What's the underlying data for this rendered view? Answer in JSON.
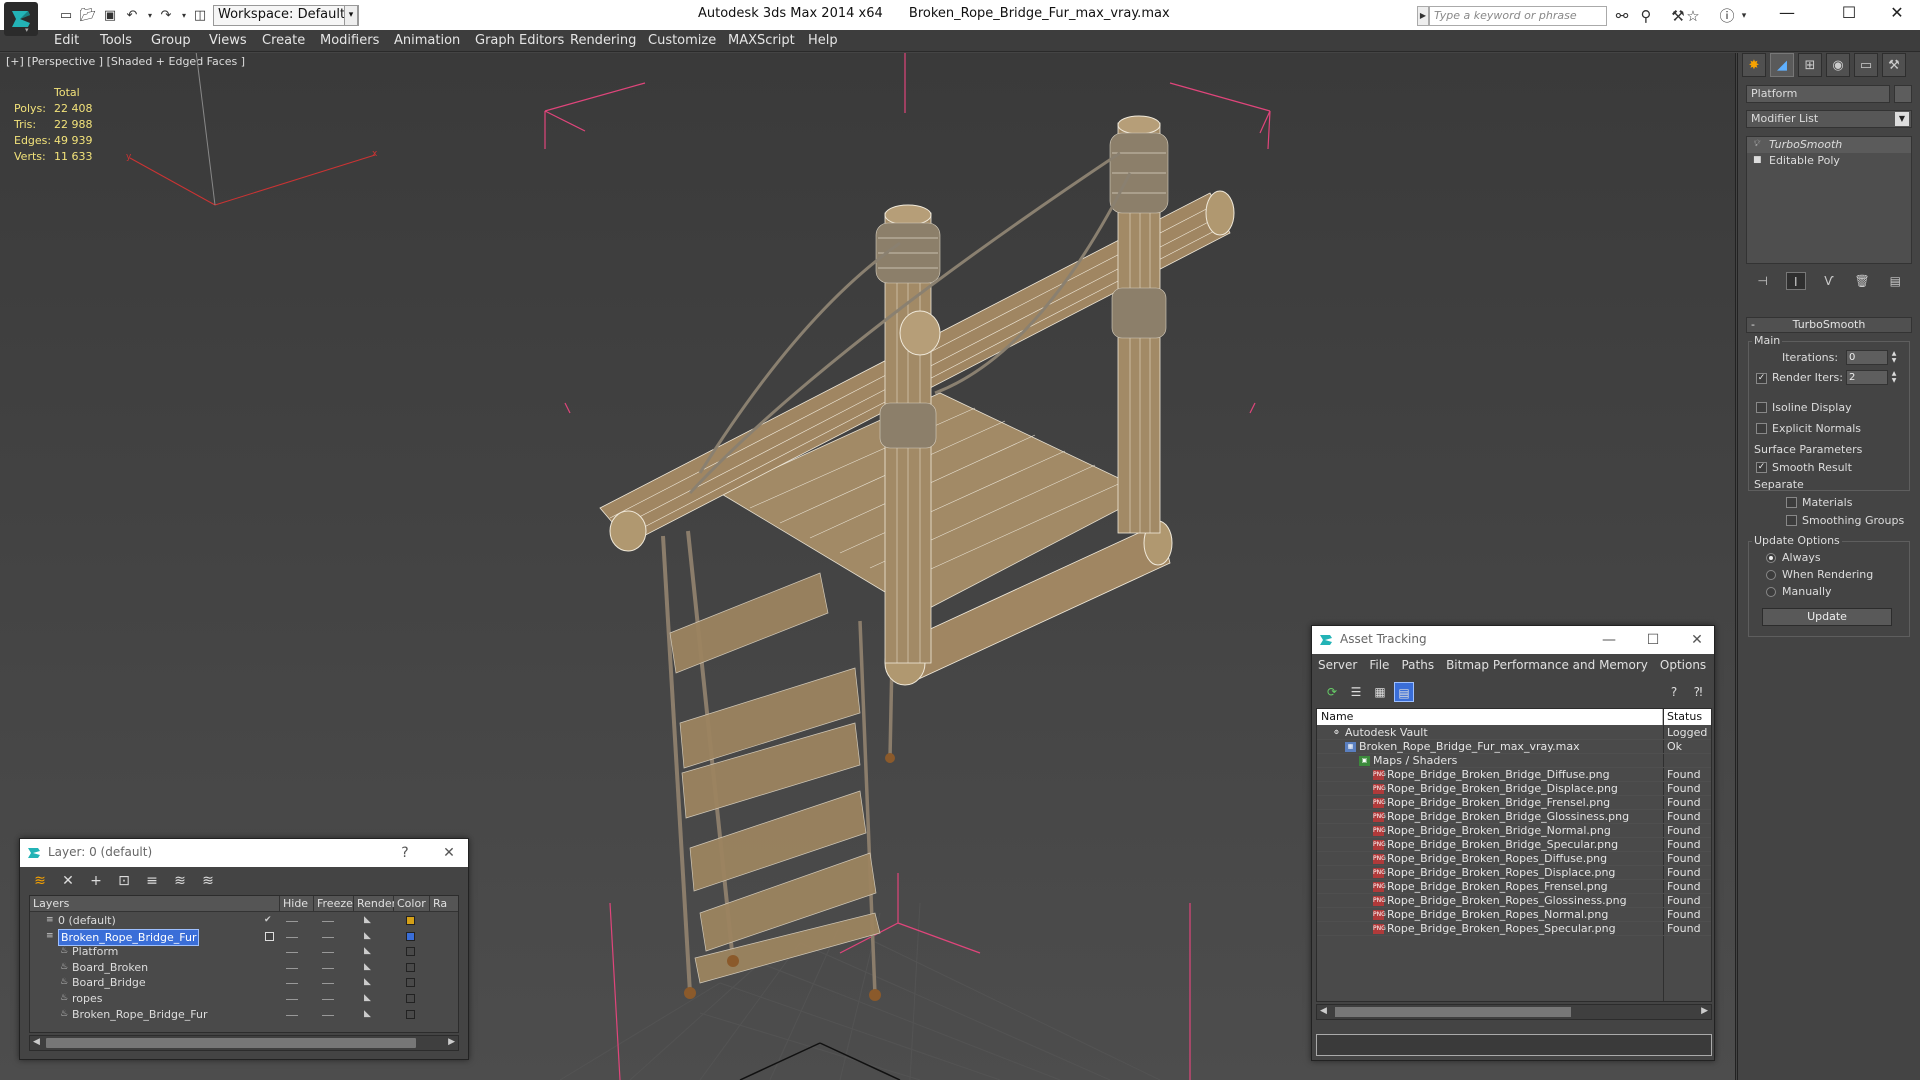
{
  "titlebar": {
    "app_title": "Autodesk 3ds Max  2014 x64",
    "file_title": "Broken_Rope_Bridge_Fur_max_vray.max",
    "workspace": "Workspace: Default",
    "search_placeholder": "Type a keyword or phrase"
  },
  "menu": [
    "Edit",
    "Tools",
    "Group",
    "Views",
    "Create",
    "Modifiers",
    "Animation",
    "Graph Editors",
    "Rendering",
    "Customize",
    "MAXScript",
    "Help"
  ],
  "viewport": {
    "label": "[+] [Perspective ] [Shaded + Edged Faces ]",
    "stats_header": "Total",
    "stats": [
      {
        "k": "Polys:",
        "v": "22 408"
      },
      {
        "k": "Tris:",
        "v": "22 988"
      },
      {
        "k": "Edges:",
        "v": "49 939"
      },
      {
        "k": "Verts:",
        "v": "11 633"
      }
    ],
    "axis_x": "x",
    "axis_y": "y"
  },
  "command_panel": {
    "object_name": "Platform",
    "modifier_list": "Modifier List",
    "stack": [
      "TurboSmooth",
      "Editable Poly"
    ],
    "turbosmooth": {
      "title": "TurboSmooth",
      "main": "Main",
      "iterations_label": "Iterations:",
      "iterations_value": "0",
      "render_iters_label": "Render Iters:",
      "render_iters_value": "2",
      "isoline": "Isoline Display",
      "explicit_normals": "Explicit Normals",
      "surface_params": "Surface Parameters",
      "smooth_result": "Smooth Result",
      "separate": "Separate",
      "materials": "Materials",
      "smoothing_groups": "Smoothing Groups",
      "update_options": "Update Options",
      "always": "Always",
      "when_rendering": "When Rendering",
      "manually": "Manually",
      "update_btn": "Update"
    }
  },
  "layer_dialog": {
    "title": "Layer: 0 (default)",
    "help": "?",
    "columns": [
      "Layers",
      "Hide",
      "Freeze",
      "Render",
      "Color",
      "Ra"
    ],
    "rows": [
      {
        "name": "0 (default)",
        "color": "#d4a017",
        "level": 0,
        "selected": false,
        "check": true
      },
      {
        "name": "Broken_Rope_Bridge_Fur",
        "color": "#3a6ed8",
        "level": 0,
        "selected": true,
        "check": false
      },
      {
        "name": "Platform",
        "color": "#4a4a4a",
        "level": 1,
        "selected": false,
        "check": false
      },
      {
        "name": "Board_Broken",
        "color": "#4a4a4a",
        "level": 1,
        "selected": false,
        "check": false
      },
      {
        "name": "Board_Bridge",
        "color": "#4a4a4a",
        "level": 1,
        "selected": false,
        "check": false
      },
      {
        "name": "ropes",
        "color": "#4a4a4a",
        "level": 1,
        "selected": false,
        "check": false
      },
      {
        "name": "Broken_Rope_Bridge_Fur",
        "color": "#4a4a4a",
        "level": 1,
        "selected": false,
        "check": false
      }
    ]
  },
  "asset_dialog": {
    "title": "Asset Tracking",
    "menu": [
      "Server",
      "File",
      "Paths",
      "Bitmap Performance and Memory",
      "Options"
    ],
    "columns": [
      "Name",
      "Status"
    ],
    "rows": [
      {
        "name": "Autodesk Vault",
        "status": "Logged",
        "level": 0,
        "type": "vault"
      },
      {
        "name": "Broken_Rope_Bridge_Fur_max_vray.max",
        "status": "Ok",
        "level": 1,
        "type": "max"
      },
      {
        "name": "Maps / Shaders",
        "status": "",
        "level": 2,
        "type": "folder"
      },
      {
        "name": "Rope_Bridge_Broken_Bridge_Diffuse.png",
        "status": "Found",
        "level": 3,
        "type": "png"
      },
      {
        "name": "Rope_Bridge_Broken_Bridge_Displace.png",
        "status": "Found",
        "level": 3,
        "type": "png"
      },
      {
        "name": "Rope_Bridge_Broken_Bridge_Frensel.png",
        "status": "Found",
        "level": 3,
        "type": "png"
      },
      {
        "name": "Rope_Bridge_Broken_Bridge_Glossiness.png",
        "status": "Found",
        "level": 3,
        "type": "png"
      },
      {
        "name": "Rope_Bridge_Broken_Bridge_Normal.png",
        "status": "Found",
        "level": 3,
        "type": "png"
      },
      {
        "name": "Rope_Bridge_Broken_Bridge_Specular.png",
        "status": "Found",
        "level": 3,
        "type": "png"
      },
      {
        "name": "Rope_Bridge_Broken_Ropes_Diffuse.png",
        "status": "Found",
        "level": 3,
        "type": "png"
      },
      {
        "name": "Rope_Bridge_Broken_Ropes_Displace.png",
        "status": "Found",
        "level": 3,
        "type": "png"
      },
      {
        "name": "Rope_Bridge_Broken_Ropes_Frensel.png",
        "status": "Found",
        "level": 3,
        "type": "png"
      },
      {
        "name": "Rope_Bridge_Broken_Ropes_Glossiness.png",
        "status": "Found",
        "level": 3,
        "type": "png"
      },
      {
        "name": "Rope_Bridge_Broken_Ropes_Normal.png",
        "status": "Found",
        "level": 3,
        "type": "png"
      },
      {
        "name": "Rope_Bridge_Broken_Ropes_Specular.png",
        "status": "Found",
        "level": 3,
        "type": "png"
      }
    ]
  },
  "colors": {
    "accent": "#3a6ed8",
    "stats": "#f2e27a",
    "wood": "#9c8460",
    "bbox": "#e0457b"
  }
}
